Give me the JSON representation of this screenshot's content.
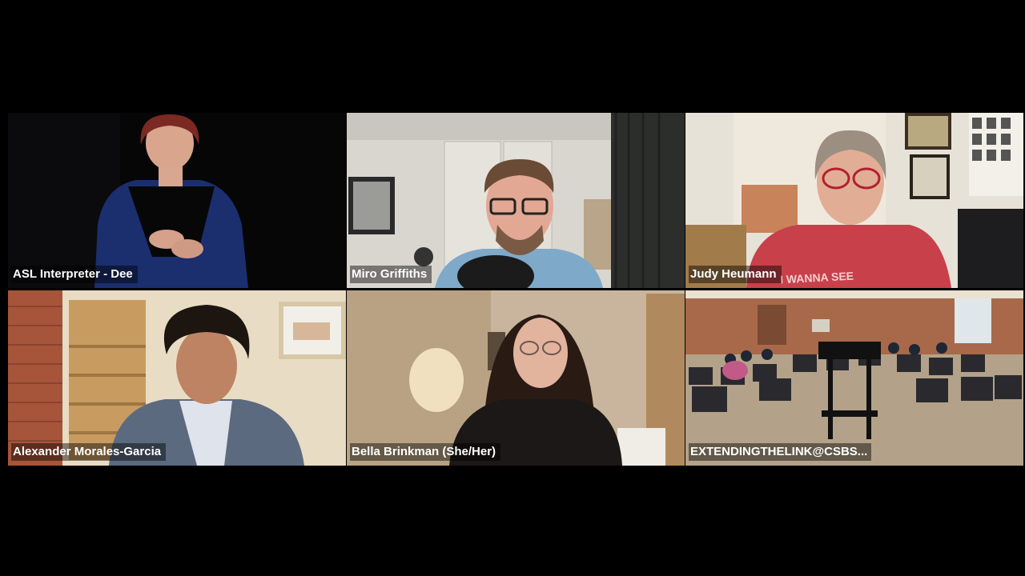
{
  "meeting": {
    "participants": [
      {
        "name": "ASL Interpreter - Dee"
      },
      {
        "name": "Miro Griffiths"
      },
      {
        "name": "Judy Heumann"
      },
      {
        "name": "Alexander Morales-Garcia"
      },
      {
        "name": "Bella Brinkman (She/Her)"
      },
      {
        "name": "EXTENDINGTHELINK@CSBS..."
      }
    ]
  },
  "tee_text": "I WANNA SEE"
}
